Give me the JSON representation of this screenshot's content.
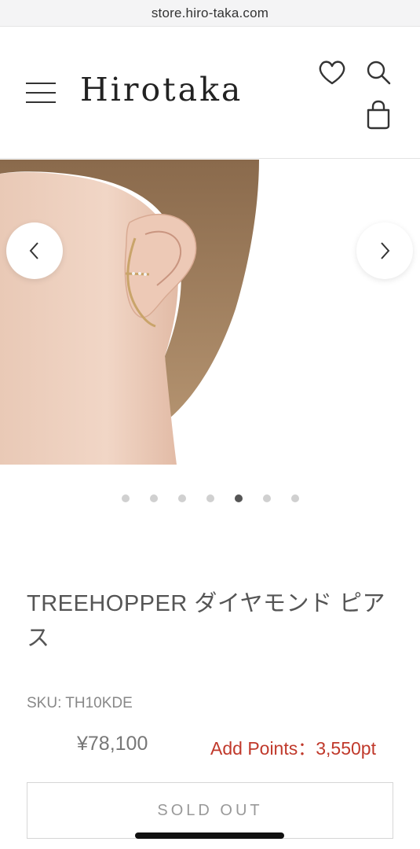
{
  "browser": {
    "url": "store.hiro-taka.com"
  },
  "header": {
    "logo": "Hirotaka",
    "icons": [
      "menu-icon",
      "heart-icon",
      "search-icon",
      "bag-icon"
    ]
  },
  "gallery": {
    "slide_count": 7,
    "active_index": 4,
    "image_description_icon": "earring-photo"
  },
  "product": {
    "title": "TREEHOPPER ダイヤモンド ピアス",
    "sku": "SKU: TH10KDE",
    "price": "¥78,100",
    "points": "Add Points：3,550pt",
    "sold_out_label": "SOLD OUT"
  },
  "colors": {
    "points_red": "#c0392b",
    "text_gray": "#555555"
  }
}
